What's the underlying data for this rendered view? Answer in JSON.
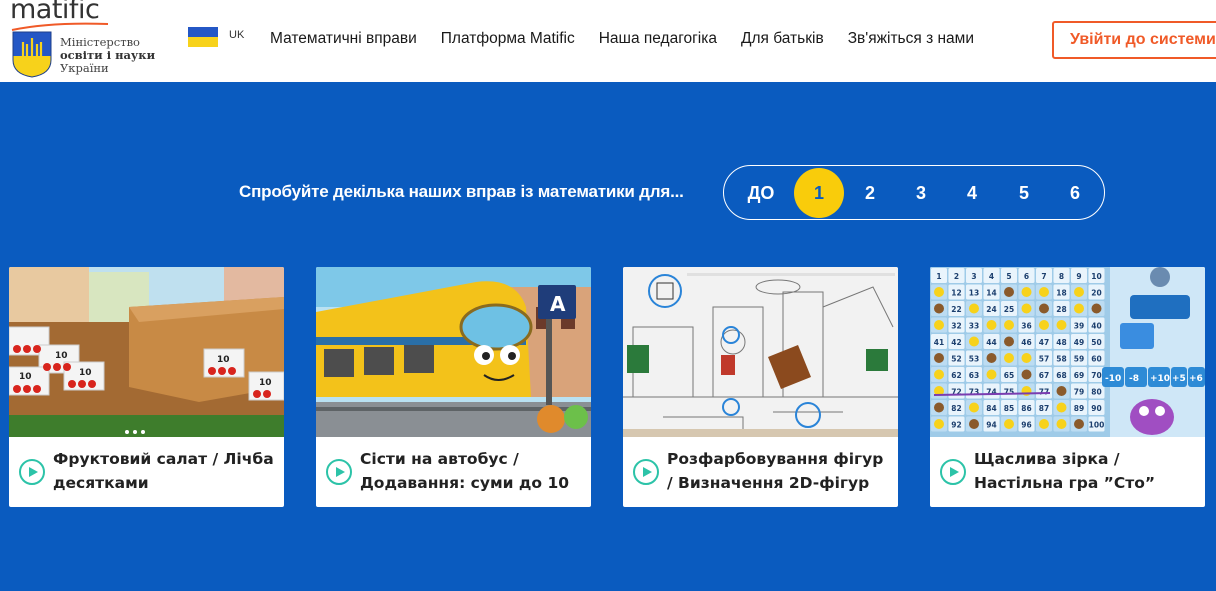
{
  "header": {
    "logo_text": "matific",
    "ministry_lines": [
      "Міністерство",
      "освіти і науки",
      "України"
    ],
    "lang_code": "UK",
    "nav": [
      "Математичні вправи",
      "Платформа Matific",
      "Наша педагогіка",
      "Для батьків",
      "Зв'яжіться з нами"
    ],
    "login_label": "Увійти до системи"
  },
  "hero": {
    "prompt": "Спробуйте декілька наших вправ із математики для...",
    "grades": [
      "ДО",
      "1",
      "2",
      "3",
      "4",
      "5",
      "6"
    ],
    "selected_grade": "1"
  },
  "cards": [
    {
      "title": "Фруктовий салат / Лічба десятками",
      "icon": "play-icon"
    },
    {
      "title": "Сісти на автобус / Додавання: суми до 10",
      "icon": "play-icon"
    },
    {
      "title": "Розфарбовування фігур / Визначення 2D-фігур",
      "icon": "play-icon"
    },
    {
      "title": "Щаслива зірка / Настільна гра ”Сто”",
      "icon": "play-icon"
    }
  ],
  "thumb_text": {
    "fruit_boxes": [
      "10",
      "10",
      "10",
      "10",
      "10"
    ],
    "bus_stop": "A",
    "hundred_board": [
      "1",
      "2",
      "3",
      "4",
      "5",
      "6",
      "7",
      "8",
      "9",
      "10",
      "12",
      "13",
      "14",
      "18",
      "20",
      "22",
      "24",
      "25",
      "28",
      "32",
      "33",
      "36",
      "39",
      "40",
      "41",
      "42",
      "44",
      "46",
      "47",
      "48",
      "49",
      "50",
      "52",
      "53",
      "57",
      "58",
      "59",
      "60",
      "62",
      "63",
      "65",
      "67",
      "68",
      "69",
      "70",
      "72",
      "73",
      "74",
      "75",
      "77",
      "79",
      "80",
      "82",
      "84",
      "85",
      "86",
      "87",
      "89",
      "90",
      "92",
      "94",
      "96",
      "100"
    ],
    "hundred_cards": [
      "-10",
      "-8",
      "+10",
      "+5",
      "+6"
    ]
  },
  "colors": {
    "background": "#0a5bbf",
    "accent": "#f05a28",
    "grade_active": "#f9cc0b",
    "play": "#2cc3a8"
  }
}
